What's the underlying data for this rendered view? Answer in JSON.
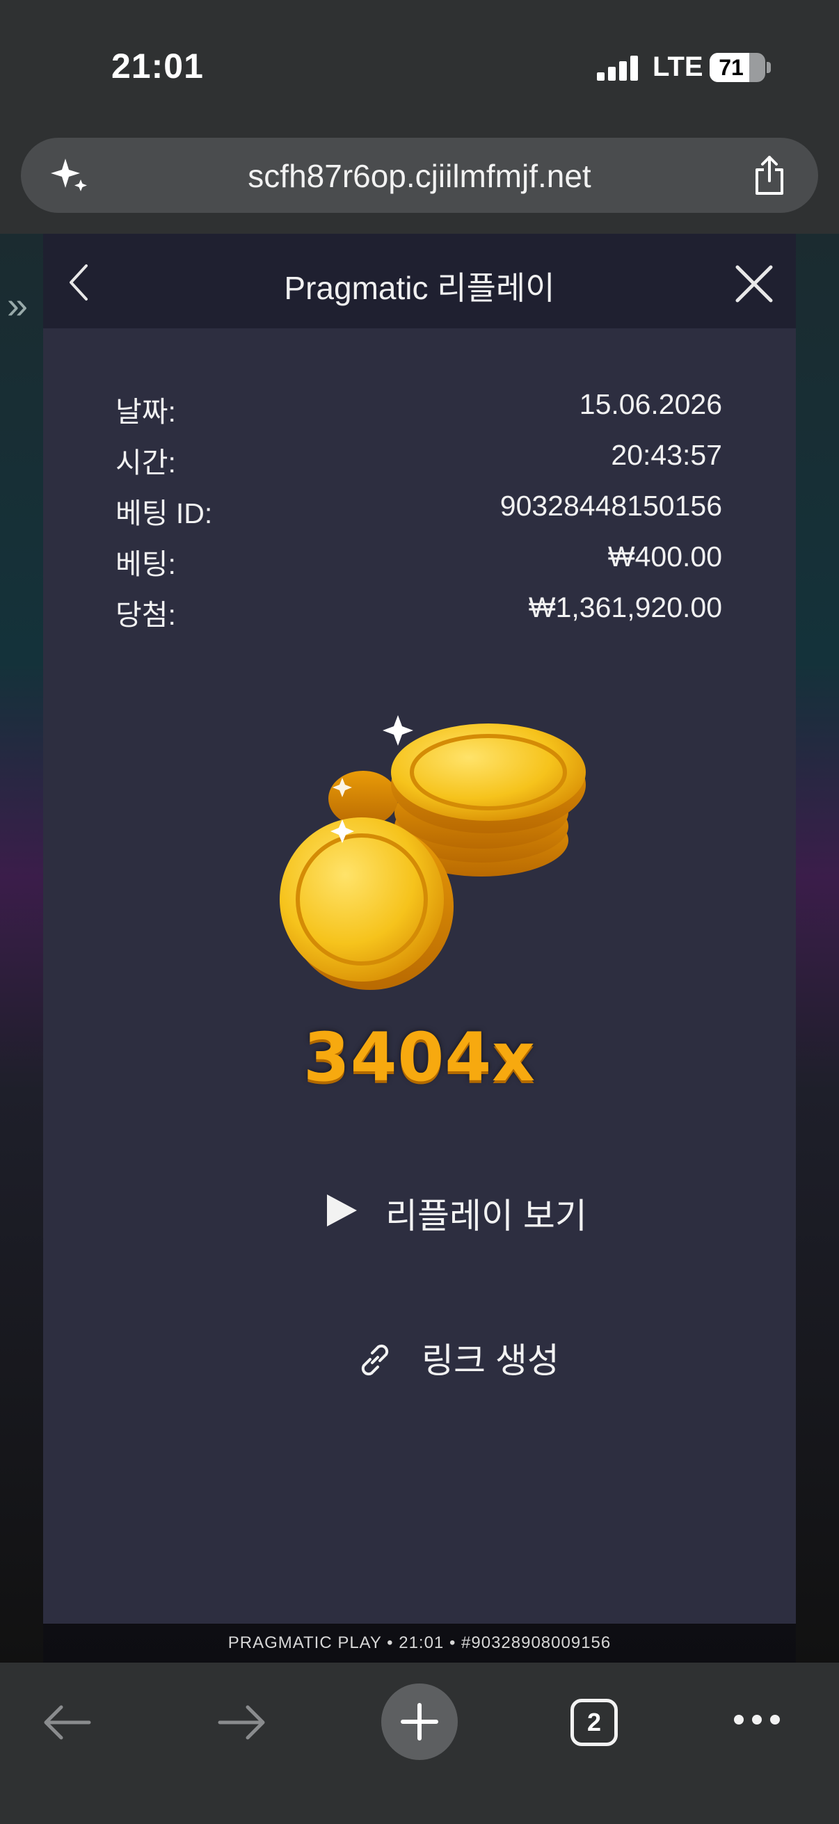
{
  "status_bar": {
    "time": "21:01",
    "network": "LTE",
    "battery": "71",
    "battery_level": 71,
    "icons": [
      "signal-icon",
      "battery-icon"
    ]
  },
  "browser": {
    "url": "scfh87r6op.cjiilmfmjf.net",
    "tab_count": "2",
    "icons": [
      "sparkle-icon",
      "share-icon",
      "back-arrow-icon",
      "forward-arrow-icon",
      "plus-icon",
      "more-icon"
    ]
  },
  "game_footer": "PRAGMATIC PLAY • 21:01 • #90328908009156",
  "modal": {
    "title": "Pragmatic 리플레이",
    "rows": [
      {
        "label": "날짜:",
        "value": "15.06.2026"
      },
      {
        "label": "시간:",
        "value": "20:43:57"
      },
      {
        "label": "베팅 ID:",
        "value": "90328448150156"
      },
      {
        "label": "베팅:",
        "value": "₩400.00"
      },
      {
        "label": "당첨:",
        "value": "₩1,361,920.00"
      }
    ],
    "multiplier": "3404x",
    "replay_label": "리플레이 보기",
    "link_label": "링크 생성"
  },
  "colors": {
    "modal_bg": "#2d2e40",
    "header_bg": "#1f2030",
    "multiplier": "#f7a90f",
    "browser_chrome": "#2f3132"
  }
}
